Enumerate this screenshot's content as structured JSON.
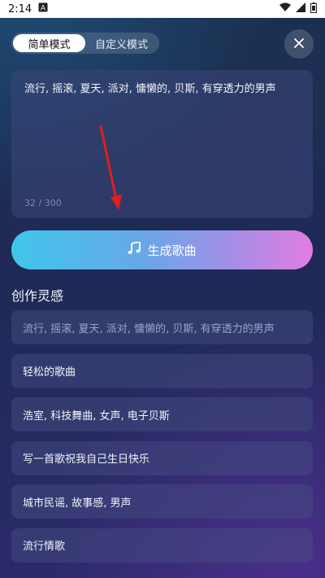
{
  "status_bar": {
    "time": "2:14",
    "notification_icon": "a-letter-icon"
  },
  "mode_switch": {
    "simple_label": "简单模式",
    "custom_label": "自定义模式",
    "active": "simple"
  },
  "prompt": {
    "text": "流行, 摇滚, 夏天, 派对, 慵懒的, 贝斯, 有穿透力的男声",
    "char_count": "32 / 300"
  },
  "generate_button": {
    "label": "生成歌曲",
    "icon": "music-note-icon"
  },
  "inspiration": {
    "title": "创作灵感",
    "items": [
      "流行, 摇滚, 夏天, 派对, 慵懒的, 贝斯, 有穿透力的男声",
      "轻松的歌曲",
      "浩室, 科技舞曲, 女声, 电子贝斯",
      "写一首歌祝我自己生日快乐",
      "城市民谣, 故事感, 男声",
      "流行情歌"
    ]
  },
  "colors": {
    "accent_start": "#3ec6ea",
    "accent_end": "#e07ee0",
    "annotation_arrow": "#e01e1e"
  }
}
